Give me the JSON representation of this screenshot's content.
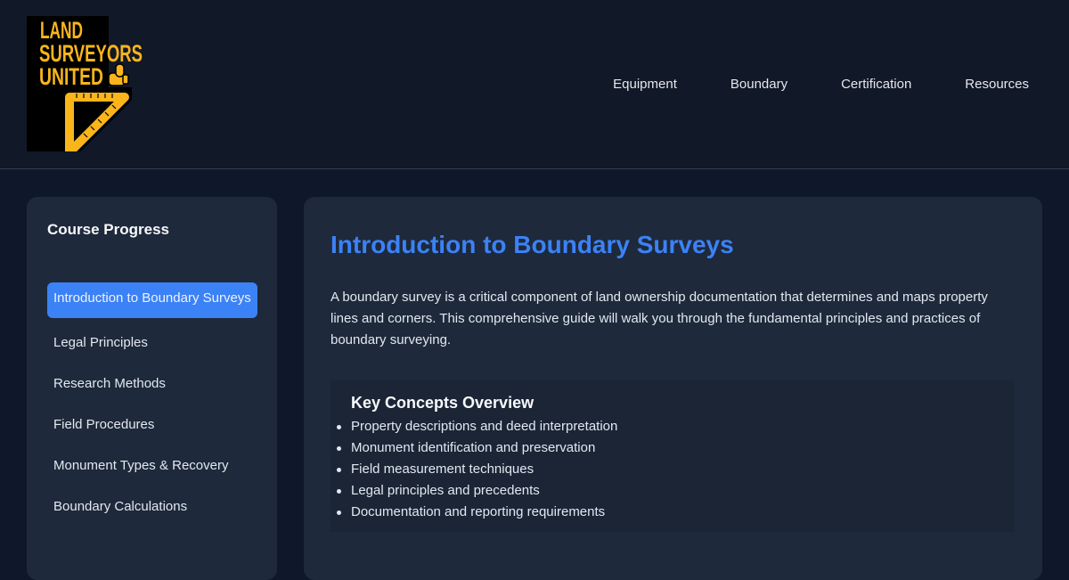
{
  "logo": {
    "line1": "LAND",
    "line2": "SURVEYORS",
    "line3": "UNITED"
  },
  "nav": [
    {
      "label": "Equipment"
    },
    {
      "label": "Boundary"
    },
    {
      "label": "Certification"
    },
    {
      "label": "Resources"
    }
  ],
  "sidebar": {
    "title": "Course Progress",
    "items": [
      {
        "label": "Introduction to Boundary Surveys"
      },
      {
        "label": "Legal Principles"
      },
      {
        "label": "Research Methods"
      },
      {
        "label": "Field Procedures"
      },
      {
        "label": "Monument Types & Recovery"
      },
      {
        "label": "Boundary Calculations"
      }
    ]
  },
  "main": {
    "title": "Introduction to Boundary Surveys",
    "intro": "A boundary survey is a critical component of land ownership documentation that determines and maps property lines and corners. This comprehensive guide will walk you through the fundamental principles and practices of boundary surveying.",
    "concepts": {
      "heading": "Key Concepts Overview",
      "items": [
        "Property descriptions and deed interpretation",
        "Monument identification and preservation",
        "Field measurement techniques",
        "Legal principles and precedents",
        "Documentation and reporting requirements"
      ]
    }
  },
  "colors": {
    "accent": "#3b82f6",
    "logo_yellow": "#f9b51a",
    "background": "#0f172a",
    "panel": "#1e293b"
  },
  "icons": [
    "thumbs-up-icon",
    "set-square-ruler-icon"
  ]
}
